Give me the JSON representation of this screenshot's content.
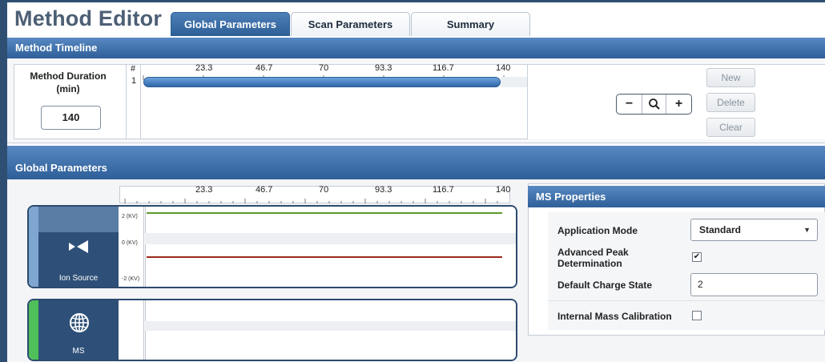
{
  "app": {
    "title": "Method Editor"
  },
  "tabs": [
    {
      "label": "Global Parameters",
      "active": true
    },
    {
      "label": "Scan Parameters",
      "active": false
    },
    {
      "label": "Summary",
      "active": false
    }
  ],
  "method_timeline": {
    "section_title": "Method Timeline",
    "duration_label": "Method Duration (min)",
    "duration_value": "140",
    "row_header": "#",
    "row_number": "1",
    "ticks": [
      "23.3",
      "46.7",
      "70",
      "93.3",
      "116.7",
      "140"
    ],
    "zoom_out_label": "−",
    "zoom_in_label": "+",
    "buttons": {
      "new_label": "New",
      "delete_label": "Delete",
      "clear_label": "Clear"
    }
  },
  "global_parameters": {
    "section_title": "Global Parameters",
    "ticks": [
      "23.3",
      "46.7",
      "70",
      "93.3",
      "116.7",
      "140"
    ],
    "tracks": [
      {
        "label": "Ion Source",
        "icon": "ion-source-icon",
        "units": [
          "2 (KV)",
          "0 (KV)",
          "-2 (KV)"
        ],
        "line_colors": [
          "#5d9a2a",
          "#9c2a1c"
        ]
      },
      {
        "label": "MS",
        "icon": "globe-icon",
        "units": []
      }
    ]
  },
  "ms_properties": {
    "title": "MS Properties",
    "application_mode_label": "Application Mode",
    "application_mode_value": "Standard",
    "advanced_peak_label": "Advanced Peak Determination",
    "advanced_peak_checked": true,
    "default_charge_label": "Default Charge State",
    "default_charge_value": "2",
    "internal_mass_label": "Internal Mass Calibration",
    "internal_mass_checked": false
  },
  "colors": {
    "accent": "#2f5f98",
    "frame": "#2f4f72",
    "ms_strip": "#4fbf5a",
    "ion_strip": "#7fa6d1"
  }
}
